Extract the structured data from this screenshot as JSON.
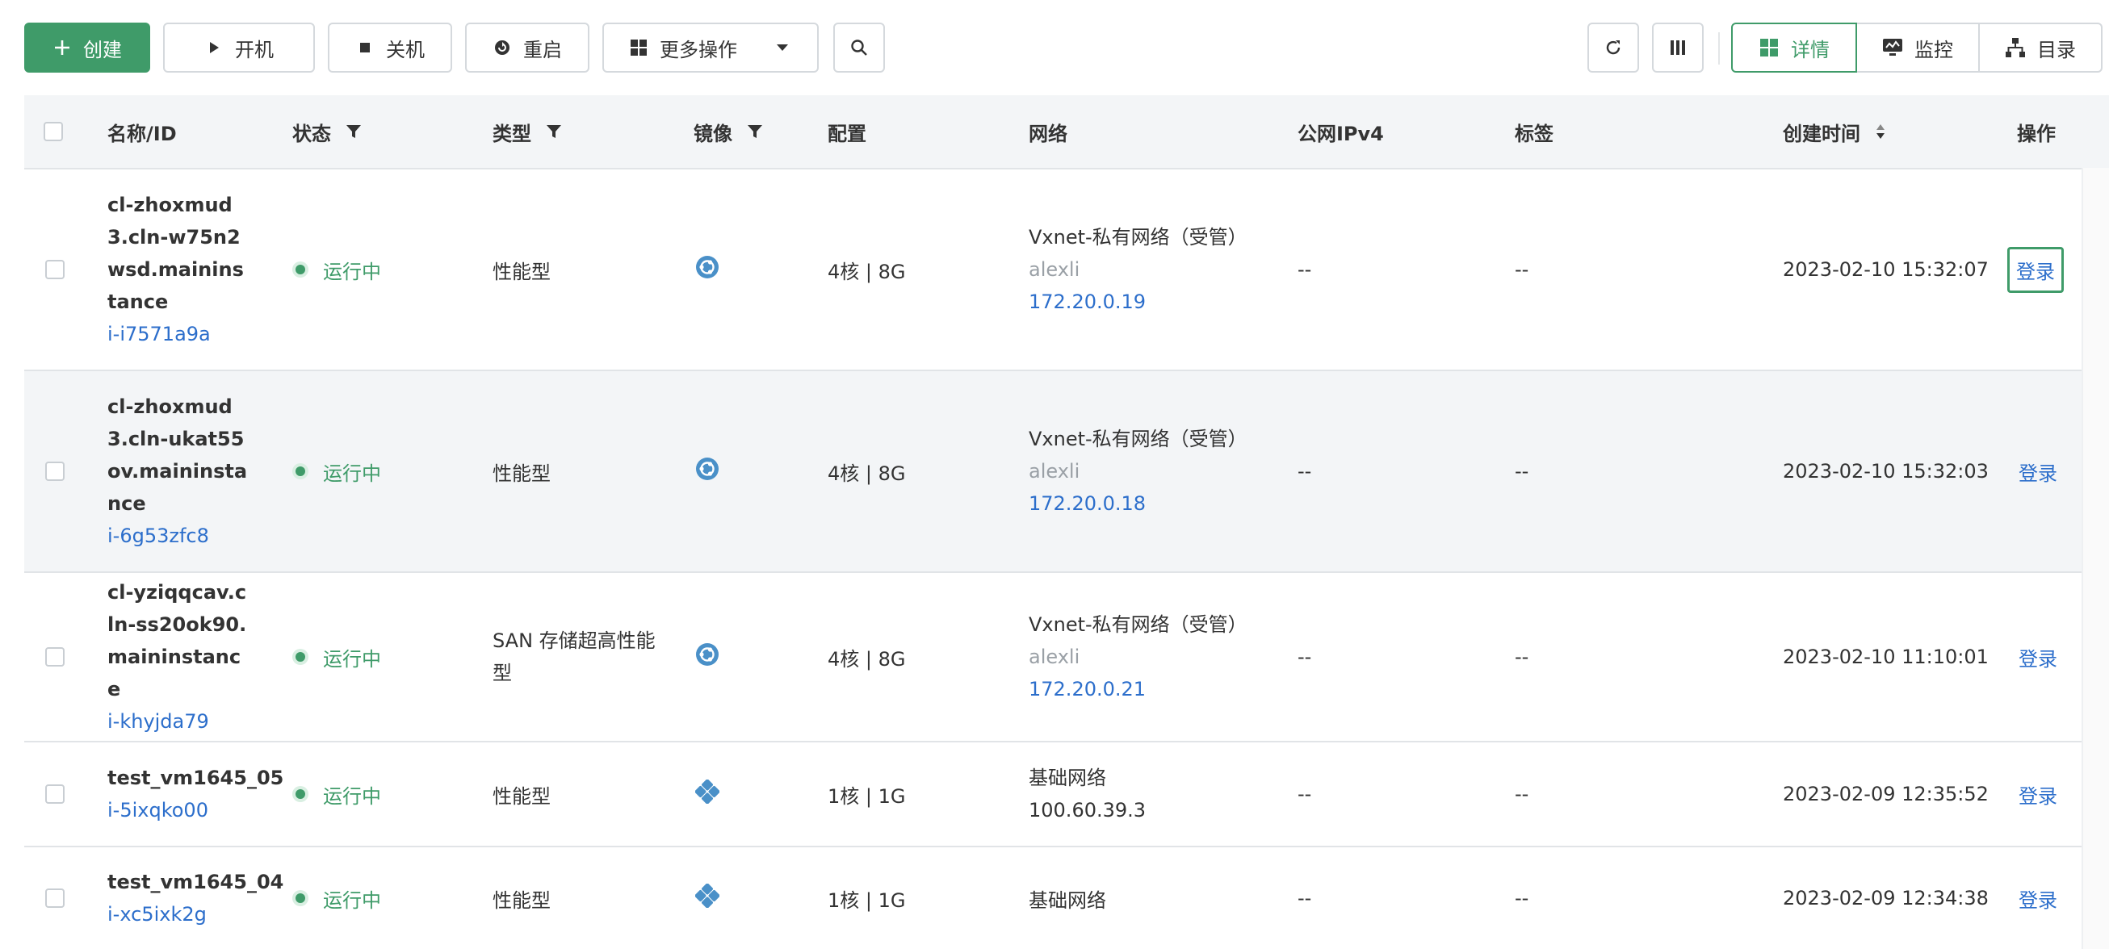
{
  "toolbar": {
    "create": "创建",
    "start": "开机",
    "stop": "关机",
    "restart": "重启",
    "more": "更多操作",
    "views": {
      "detail": "详情",
      "monitor": "监控",
      "catalog": "目录"
    }
  },
  "columns": {
    "name": "名称/ID",
    "status": "状态",
    "type": "类型",
    "image": "镜像",
    "config": "配置",
    "network": "网络",
    "ipv4": "公网IPv4",
    "tags": "标签",
    "created": "创建时间",
    "action": "操作"
  },
  "rows": [
    {
      "name": "cl-zhoxmud3.cln-w75n2wsd.maininstance",
      "id": "i-i7571a9a",
      "status": "运行中",
      "type": "性能型",
      "image_icon": "image-os-icon",
      "config": "4核 | 8G",
      "net_name": "Vxnet-私有网络（受管）",
      "net_user": "alexli",
      "net_ip": "172.20.0.19",
      "ipv4": "--",
      "tags": "--",
      "created": "2023-02-10 15:32:07",
      "action": "登录"
    },
    {
      "name": "cl-zhoxmud3.cln-ukat55ov.maininstance",
      "id": "i-6g53zfc8",
      "status": "运行中",
      "type": "性能型",
      "image_icon": "image-os-icon",
      "config": "4核 | 8G",
      "net_name": "Vxnet-私有网络（受管）",
      "net_user": "alexli",
      "net_ip": "172.20.0.18",
      "ipv4": "--",
      "tags": "--",
      "created": "2023-02-10 15:32:03",
      "action": "登录"
    },
    {
      "name": "cl-yziqqcav.cln-ss20ok90.maininstance",
      "id": "i-khyjda79",
      "status": "运行中",
      "type": "SAN 存储超高性能型",
      "image_icon": "image-os-icon",
      "config": "4核 | 8G",
      "net_name": "Vxnet-私有网络（受管）",
      "net_user": "alexli",
      "net_ip": "172.20.0.21",
      "ipv4": "--",
      "tags": "--",
      "created": "2023-02-10 11:10:01",
      "action": "登录"
    },
    {
      "name": "test_vm1645_05",
      "id": "i-5ixqko00",
      "status": "运行中",
      "type": "性能型",
      "image_icon": "image-os-icon-alt",
      "config": "1核 | 1G",
      "net_name": "基础网络",
      "net_ip": "100.60.39.3",
      "ipv4": "--",
      "tags": "--",
      "created": "2023-02-09 12:35:52",
      "action": "登录"
    },
    {
      "name": "test_vm1645_04",
      "id": "i-xc5ixk2g",
      "status": "运行中",
      "type": "性能型",
      "image_icon": "image-os-icon-alt",
      "config": "1核 | 1G",
      "net_name": "基础网络",
      "ipv4": "--",
      "tags": "--",
      "created": "2023-02-09 12:34:38",
      "action": "登录"
    }
  ],
  "colors": {
    "primary": "#3f9b69",
    "link": "#2c6ecb",
    "muted": "#9aa0a6",
    "row_alt": "#f3f5f7"
  }
}
